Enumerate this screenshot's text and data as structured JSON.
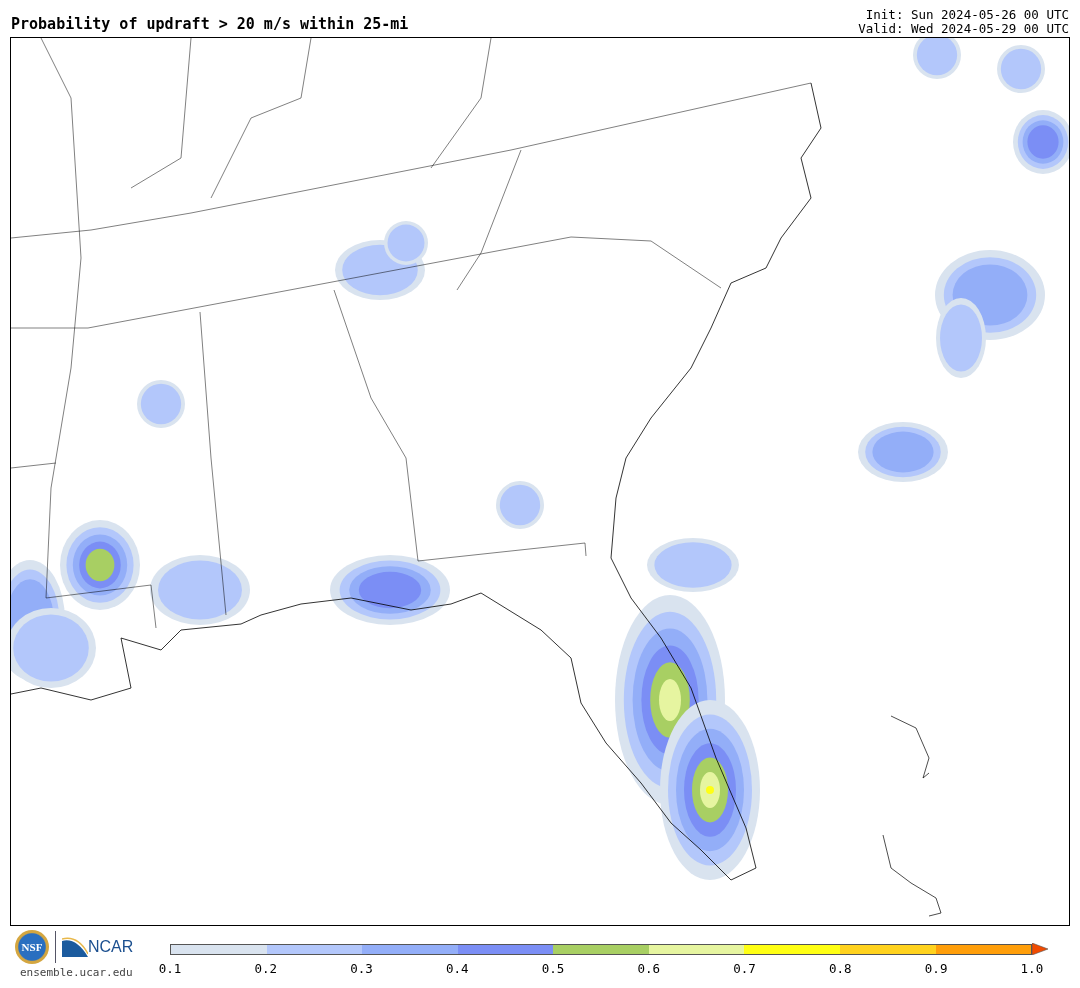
{
  "title": "Probability of updraft > 20 m/s within 25-mi",
  "init": "Init: Sun 2024-05-26 00 UTC",
  "valid": "Valid: Wed 2024-05-29 00 UTC",
  "logos": {
    "seal_text": "NSF",
    "org_text": "NCAR",
    "url": "ensemble.ucar.edu"
  },
  "colorbar": {
    "segments": [
      {
        "color": "#d9e3ef"
      },
      {
        "color": "#b3c7fb"
      },
      {
        "color": "#93aef8"
      },
      {
        "color": "#7b8ef5"
      },
      {
        "color": "#a8cf63"
      },
      {
        "color": "#e6f5a0"
      },
      {
        "color": "#ffff14"
      },
      {
        "color": "#ffd21e"
      },
      {
        "color": "#ff9e0a"
      }
    ],
    "extend_arrow": {
      "color": "#f04a00"
    },
    "ticks": [
      "0.1",
      "0.2",
      "0.3",
      "0.4",
      "0.5",
      "0.6",
      "0.7",
      "0.8",
      "0.9",
      "1.0"
    ]
  }
}
